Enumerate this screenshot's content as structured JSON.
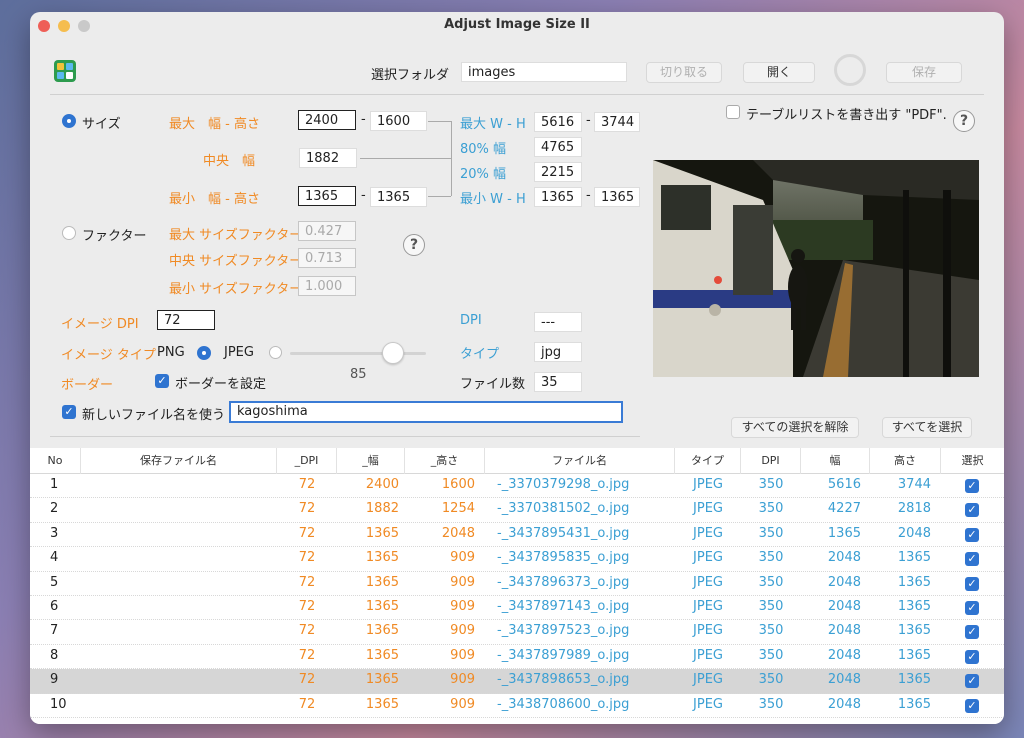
{
  "window": {
    "title": "Adjust Image Size II"
  },
  "toolbar": {
    "folder_label": "選択フォルダ",
    "folder_value": "images",
    "cut_button": "切り取る",
    "open_button": "開く",
    "save_button": "保存"
  },
  "size": {
    "radio_label": "サイズ",
    "max_label": "最大　幅 - 高さ",
    "max_w": "2400",
    "max_h": "1600",
    "mid_label": "中央　幅",
    "mid_w": "1882",
    "min_label": "最小　幅 - 高さ",
    "min_w": "1365",
    "min_h": "1365"
  },
  "stats": {
    "max_wh_label": "最大 W - H",
    "max_w": "5616",
    "max_h": "3744",
    "w80_label": "80% 幅",
    "w80": "4765",
    "w20_label": "20% 幅",
    "w20": "2215",
    "min_wh_label": "最小 W - H",
    "min_w": "1365",
    "min_h": "1365",
    "dpi_label": "DPI",
    "dpi_value": "---",
    "type_label": "タイプ",
    "type_value": "jpg",
    "count_label": "ファイル数",
    "count_value": "35"
  },
  "factor": {
    "radio_label": "ファクター",
    "max_label": "最大 サイズファクター",
    "max_value": "0.427",
    "mid_label": "中央 サイズファクター",
    "mid_value": "0.713",
    "min_label": "最小 サイズファクター",
    "min_value": "1.000"
  },
  "image": {
    "dpi_label": "イメージ DPI",
    "dpi_value": "72",
    "type_label": "イメージ タイプ",
    "png_label": "PNG",
    "jpeg_label": "JPEG",
    "quality_value": "85",
    "border_label": "ボーダー",
    "border_check_label": "ボーダーを設定",
    "newname_label": "新しいファイル名を使う",
    "newname_value": "kagoshima"
  },
  "export": {
    "pdf_label": "テーブルリストを書き出す \"PDF\"."
  },
  "buttons": {
    "deselect_all": "すべての選択を解除",
    "select_all": "すべてを選択"
  },
  "table": {
    "headers": [
      "No",
      "保存ファイル名",
      "_DPI",
      "_幅",
      "_高さ",
      "ファイル名",
      "タイプ",
      "DPI",
      "幅",
      "高さ",
      "選択"
    ],
    "rows": [
      {
        "no": "1",
        "save": "",
        "dpi_out": "72",
        "w_out": "2400",
        "h_out": "1600",
        "file": "-_3370379298_o.jpg",
        "type": "JPEG",
        "dpi": "350",
        "w": "5616",
        "h": "3744",
        "selected": true
      },
      {
        "no": "2",
        "save": "",
        "dpi_out": "72",
        "w_out": "1882",
        "h_out": "1254",
        "file": "-_3370381502_o.jpg",
        "type": "JPEG",
        "dpi": "350",
        "w": "4227",
        "h": "2818",
        "selected": true
      },
      {
        "no": "3",
        "save": "",
        "dpi_out": "72",
        "w_out": "1365",
        "h_out": "2048",
        "file": "-_3437895431_o.jpg",
        "type": "JPEG",
        "dpi": "350",
        "w": "1365",
        "h": "2048",
        "selected": true
      },
      {
        "no": "4",
        "save": "",
        "dpi_out": "72",
        "w_out": "1365",
        "h_out": "909",
        "file": "-_3437895835_o.jpg",
        "type": "JPEG",
        "dpi": "350",
        "w": "2048",
        "h": "1365",
        "selected": true
      },
      {
        "no": "5",
        "save": "",
        "dpi_out": "72",
        "w_out": "1365",
        "h_out": "909",
        "file": "-_3437896373_o.jpg",
        "type": "JPEG",
        "dpi": "350",
        "w": "2048",
        "h": "1365",
        "selected": true
      },
      {
        "no": "6",
        "save": "",
        "dpi_out": "72",
        "w_out": "1365",
        "h_out": "909",
        "file": "-_3437897143_o.jpg",
        "type": "JPEG",
        "dpi": "350",
        "w": "2048",
        "h": "1365",
        "selected": true
      },
      {
        "no": "7",
        "save": "",
        "dpi_out": "72",
        "w_out": "1365",
        "h_out": "909",
        "file": "-_3437897523_o.jpg",
        "type": "JPEG",
        "dpi": "350",
        "w": "2048",
        "h": "1365",
        "selected": true
      },
      {
        "no": "8",
        "save": "",
        "dpi_out": "72",
        "w_out": "1365",
        "h_out": "909",
        "file": "-_3437897989_o.jpg",
        "type": "JPEG",
        "dpi": "350",
        "w": "2048",
        "h": "1365",
        "selected": true
      },
      {
        "no": "9",
        "save": "",
        "dpi_out": "72",
        "w_out": "1365",
        "h_out": "909",
        "file": "-_3437898653_o.jpg",
        "type": "JPEG",
        "dpi": "350",
        "w": "2048",
        "h": "1365",
        "selected": true,
        "highlight": true
      },
      {
        "no": "10",
        "save": "",
        "dpi_out": "72",
        "w_out": "1365",
        "h_out": "909",
        "file": "-_3438708600_o.jpg",
        "type": "JPEG",
        "dpi": "350",
        "w": "2048",
        "h": "1365",
        "selected": true
      }
    ]
  },
  "colors": {
    "accent_orange": "#f08a24",
    "accent_blue": "#3b9fd3",
    "checkbox_blue": "#2f74d0"
  }
}
